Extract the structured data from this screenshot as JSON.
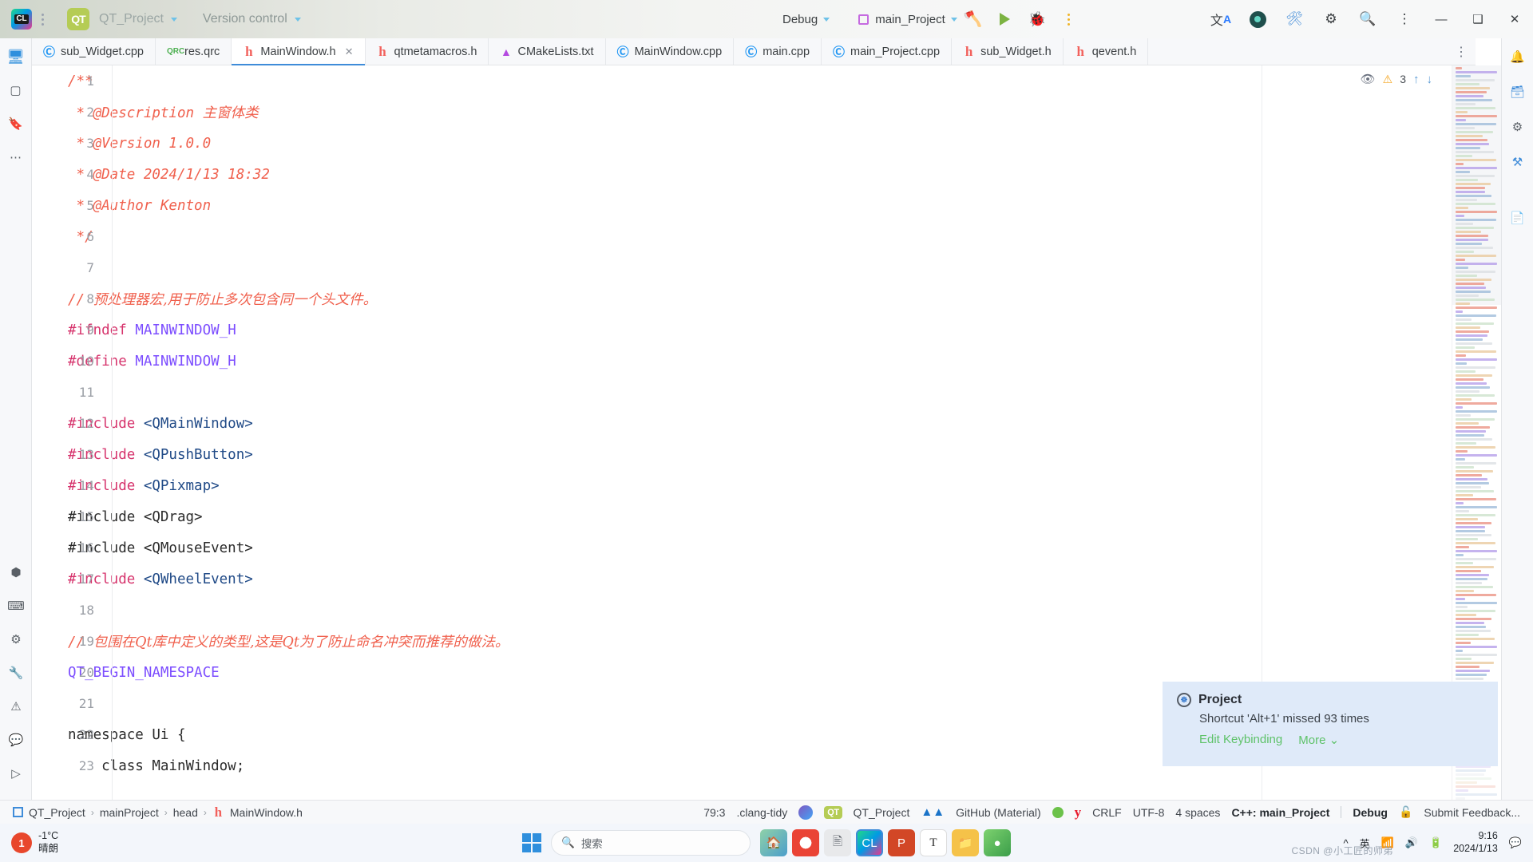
{
  "titlebar": {
    "app_icon": "clion-logo",
    "project_name": "QT_Project",
    "vcs_label": "Version control",
    "build_config": "Debug",
    "run_config": "main_Project",
    "icons": [
      "hammer-icon",
      "run-icon",
      "debug-icon",
      "more-options-icon",
      "translate-icon",
      "profile-avatar"
    ],
    "window_minimize": "—",
    "window_maximize": "❑",
    "window_close": "✕"
  },
  "tabs": [
    {
      "label": "sub_Widget.cpp",
      "icon": "cpp-file-icon",
      "kind": "cpp",
      "active": false,
      "closable": false
    },
    {
      "label": "res.qrc",
      "icon": "qrc-file-icon",
      "kind": "qrc",
      "active": false,
      "closable": false
    },
    {
      "label": "MainWindow.h",
      "icon": "header-file-icon",
      "kind": "h",
      "active": true,
      "closable": true
    },
    {
      "label": "qtmetamacros.h",
      "icon": "header-file-icon",
      "kind": "h",
      "active": false,
      "closable": false
    },
    {
      "label": "CMakeLists.txt",
      "icon": "cmake-file-icon",
      "kind": "cmake",
      "active": false,
      "closable": false
    },
    {
      "label": "MainWindow.cpp",
      "icon": "cpp-file-icon",
      "kind": "cpp",
      "active": false,
      "closable": false
    },
    {
      "label": "main.cpp",
      "icon": "cpp-file-icon",
      "kind": "cpp",
      "active": false,
      "closable": false
    },
    {
      "label": "main_Project.cpp",
      "icon": "cpp-file-icon",
      "kind": "cpp",
      "active": false,
      "closable": false
    },
    {
      "label": "sub_Widget.h",
      "icon": "header-file-icon",
      "kind": "h",
      "active": false,
      "closable": false
    },
    {
      "label": "qevent.h",
      "icon": "header-file-icon",
      "kind": "h",
      "active": false,
      "closable": false
    }
  ],
  "tab_close_glyph": "✕",
  "editor": {
    "inspection": {
      "warning_count": "3",
      "eye_icon": "eye-off-icon",
      "up_icon": "↑",
      "down_icon": "↓",
      "warn_icon": "⚠"
    },
    "lines": [
      {
        "n": "1",
        "tokens": [
          {
            "t": "/**",
            "c": "cm"
          }
        ]
      },
      {
        "n": "2",
        "tokens": [
          {
            "t": " * @Description ",
            "c": "cm"
          },
          {
            "t": "主窗体类",
            "c": "cm-cjk"
          }
        ]
      },
      {
        "n": "3",
        "tokens": [
          {
            "t": " * @Version 1.0.0",
            "c": "cm"
          }
        ]
      },
      {
        "n": "4",
        "tokens": [
          {
            "t": " * @Date 2024/1/13 18:32",
            "c": "cm"
          }
        ]
      },
      {
        "n": "5",
        "tokens": [
          {
            "t": " * @Author Kenton",
            "c": "cm"
          }
        ]
      },
      {
        "n": "6",
        "tokens": [
          {
            "t": " */",
            "c": "cm"
          }
        ]
      },
      {
        "n": "7",
        "tokens": []
      },
      {
        "n": "8",
        "tokens": [
          {
            "t": "// ",
            "c": "cm"
          },
          {
            "t": "预处理器宏,用于防止多次包含同一个头文件。",
            "c": "cm-cjk"
          }
        ]
      },
      {
        "n": "9",
        "tokens": [
          {
            "t": "#ifndef ",
            "c": "kw"
          },
          {
            "t": "MAINWINDOW_H",
            "c": "macro"
          }
        ]
      },
      {
        "n": "10",
        "tokens": [
          {
            "t": "#define ",
            "c": "kw"
          },
          {
            "t": "MAINWINDOW_H",
            "c": "macro"
          }
        ]
      },
      {
        "n": "11",
        "tokens": []
      },
      {
        "n": "12",
        "tokens": [
          {
            "t": "#include ",
            "c": "kw"
          },
          {
            "t": "<QMainWindow>",
            "c": "inc"
          }
        ]
      },
      {
        "n": "13",
        "tokens": [
          {
            "t": "#include ",
            "c": "kw"
          },
          {
            "t": "<QPushButton>",
            "c": "inc"
          }
        ]
      },
      {
        "n": "14",
        "tokens": [
          {
            "t": "#include ",
            "c": "kw"
          },
          {
            "t": "<QPixmap>",
            "c": "inc"
          }
        ]
      },
      {
        "n": "15",
        "tokens": [
          {
            "t": "#include ",
            "c": "plain"
          },
          {
            "t": "<QDrag>",
            "c": "plain"
          }
        ]
      },
      {
        "n": "16",
        "tokens": [
          {
            "t": "#include ",
            "c": "plain"
          },
          {
            "t": "<QMouseEvent>",
            "c": "plain"
          }
        ]
      },
      {
        "n": "17",
        "tokens": [
          {
            "t": "#include ",
            "c": "kw"
          },
          {
            "t": "<QWheelEvent>",
            "c": "inc"
          }
        ]
      },
      {
        "n": "18",
        "tokens": []
      },
      {
        "n": "19",
        "tokens": [
          {
            "t": "// ",
            "c": "cm"
          },
          {
            "t": "包围在Qt库中定义的类型,这是Qt为了防止命名冲突而推荐的做法。",
            "c": "cm-cjk"
          }
        ]
      },
      {
        "n": "20",
        "tokens": [
          {
            "t": "QT_BEGIN_NAMESPACE",
            "c": "ns"
          }
        ]
      },
      {
        "n": "21",
        "tokens": []
      },
      {
        "n": "22",
        "tokens": [
          {
            "t": "namespace Ui {",
            "c": "plain"
          }
        ]
      },
      {
        "n": "23",
        "tokens": [
          {
            "t": "    class MainWindow;",
            "c": "plain"
          }
        ]
      }
    ]
  },
  "notification": {
    "icon": "project-tool-icon",
    "title": "Project",
    "message": "Shortcut 'Alt+1' missed 93 times",
    "action_primary": "Edit Keybinding",
    "action_secondary": "More",
    "chevron": "⌄"
  },
  "statusbar": {
    "breadcrumbs": [
      "QT_Project",
      "mainProject",
      "head",
      "MainWindow.h"
    ],
    "separator": "›",
    "caret_position": "79:3",
    "inspection_profile": ".clang-tidy",
    "qt_chip": "QT",
    "project": "QT_Project",
    "vcs_branch": "GitHub (Material)",
    "line_separator": "CRLF",
    "encoding": "UTF-8",
    "indent": "4 spaces",
    "toolchain": "C++: main_Project",
    "toolchain_config": "Debug",
    "feedback": "Submit Feedback..."
  },
  "taskbar": {
    "weather_temp": "-1°C",
    "weather_desc": "晴朗",
    "weather_badge": "1",
    "search_placeholder": "搜索",
    "ime_label": "英",
    "clock_time": "9:16",
    "clock_date": "2024/1/13",
    "watermark": "CSDN @小工匠的师弟",
    "apps": [
      "windows-start-icon",
      "search-box",
      "weather-widget-icon",
      "chrome-icon",
      "wechat-icon",
      "file-explorer-icon",
      "clion-taskbar-icon",
      "powerpoint-icon",
      "typora-icon",
      "folder-icon",
      "app-green-icon"
    ],
    "tray_icons": [
      "chevron-up-icon",
      "ime-icon",
      "network-icon",
      "volume-icon",
      "battery-icon",
      "notification-icon"
    ]
  }
}
